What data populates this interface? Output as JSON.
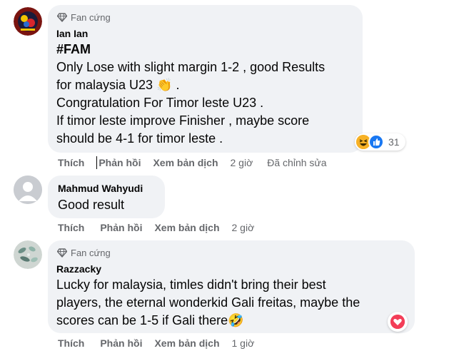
{
  "badge_label": "Fan cứng",
  "comments": [
    {
      "author": "Ian Ian",
      "has_badge": true,
      "lines": [
        "#FAM",
        "Only Lose with slight margin 1-2 , good Results",
        "for malaysia U23 👏 .",
        "Congratulation For Timor leste U23 .",
        "If timor leste improve Finisher , maybe score",
        "should be 4-1 for timor leste ."
      ],
      "reaction_count": "31",
      "reactions": [
        "haha",
        "like"
      ],
      "actions": {
        "like": "Thích",
        "reply": "Phản hồi",
        "translate": "Xem bản dịch"
      },
      "time": "2 giờ",
      "edited": "Đã chỉnh sửa"
    },
    {
      "author": "Mahmud Wahyudi",
      "has_badge": false,
      "lines": [
        "Good result"
      ],
      "actions": {
        "like": "Thích",
        "reply": "Phản hồi",
        "translate": "Xem bản dịch"
      },
      "time": "2 giờ"
    },
    {
      "author": "Razzacky",
      "has_badge": true,
      "lines": [
        "Lucky for malaysia, timles didn't bring their best",
        "players, the eternal wonderkid Gali freitas, maybe the",
        "scores can be 1-5 if Gali there🤣"
      ],
      "reactions": [
        "love"
      ],
      "actions": {
        "like": "Thích",
        "reply": "Phản hồi",
        "translate": "Xem bản dịch"
      },
      "time": "1 giờ"
    }
  ],
  "colors": {
    "bubble": "#f0f2f5",
    "secondary_text": "#65676b",
    "like_blue": "#1877f2",
    "love_red": "#f33e58",
    "haha_yellow": "#f7b125"
  }
}
